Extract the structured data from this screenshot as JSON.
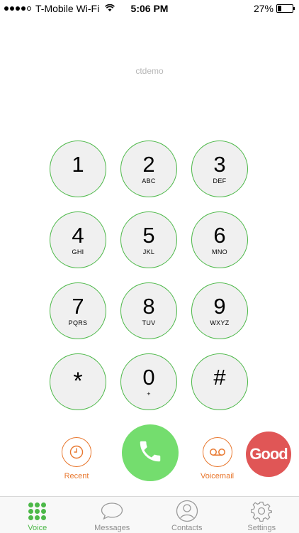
{
  "status_bar": {
    "carrier": "T-Mobile Wi-Fi",
    "time": "5:06 PM",
    "battery": "27%",
    "battery_level": 0.27
  },
  "account_label": "ctdemo",
  "keypad": [
    {
      "digit": "1",
      "letters": ""
    },
    {
      "digit": "2",
      "letters": "ABC"
    },
    {
      "digit": "3",
      "letters": "DEF"
    },
    {
      "digit": "4",
      "letters": "GHI"
    },
    {
      "digit": "5",
      "letters": "JKL"
    },
    {
      "digit": "6",
      "letters": "MNO"
    },
    {
      "digit": "7",
      "letters": "PQRS"
    },
    {
      "digit": "8",
      "letters": "TUV"
    },
    {
      "digit": "9",
      "letters": "WXYZ"
    },
    {
      "digit": "*",
      "letters": ""
    },
    {
      "digit": "0",
      "letters": "+"
    },
    {
      "digit": "#",
      "letters": ""
    }
  ],
  "actions": {
    "recent_label": "Recent",
    "voicemail_label": "Voicemail",
    "badge_text": "Good"
  },
  "tabs": [
    {
      "label": "Voice",
      "icon": "dialpad-icon",
      "active": true
    },
    {
      "label": "Messages",
      "icon": "chat-bubble-icon",
      "active": false
    },
    {
      "label": "Contacts",
      "icon": "person-icon",
      "active": false
    },
    {
      "label": "Settings",
      "icon": "gear-icon",
      "active": false
    }
  ],
  "colors": {
    "accent_green": "#4cb848",
    "call_green": "#74dd6e",
    "orange": "#e8772e",
    "badge_red": "#e05656"
  }
}
